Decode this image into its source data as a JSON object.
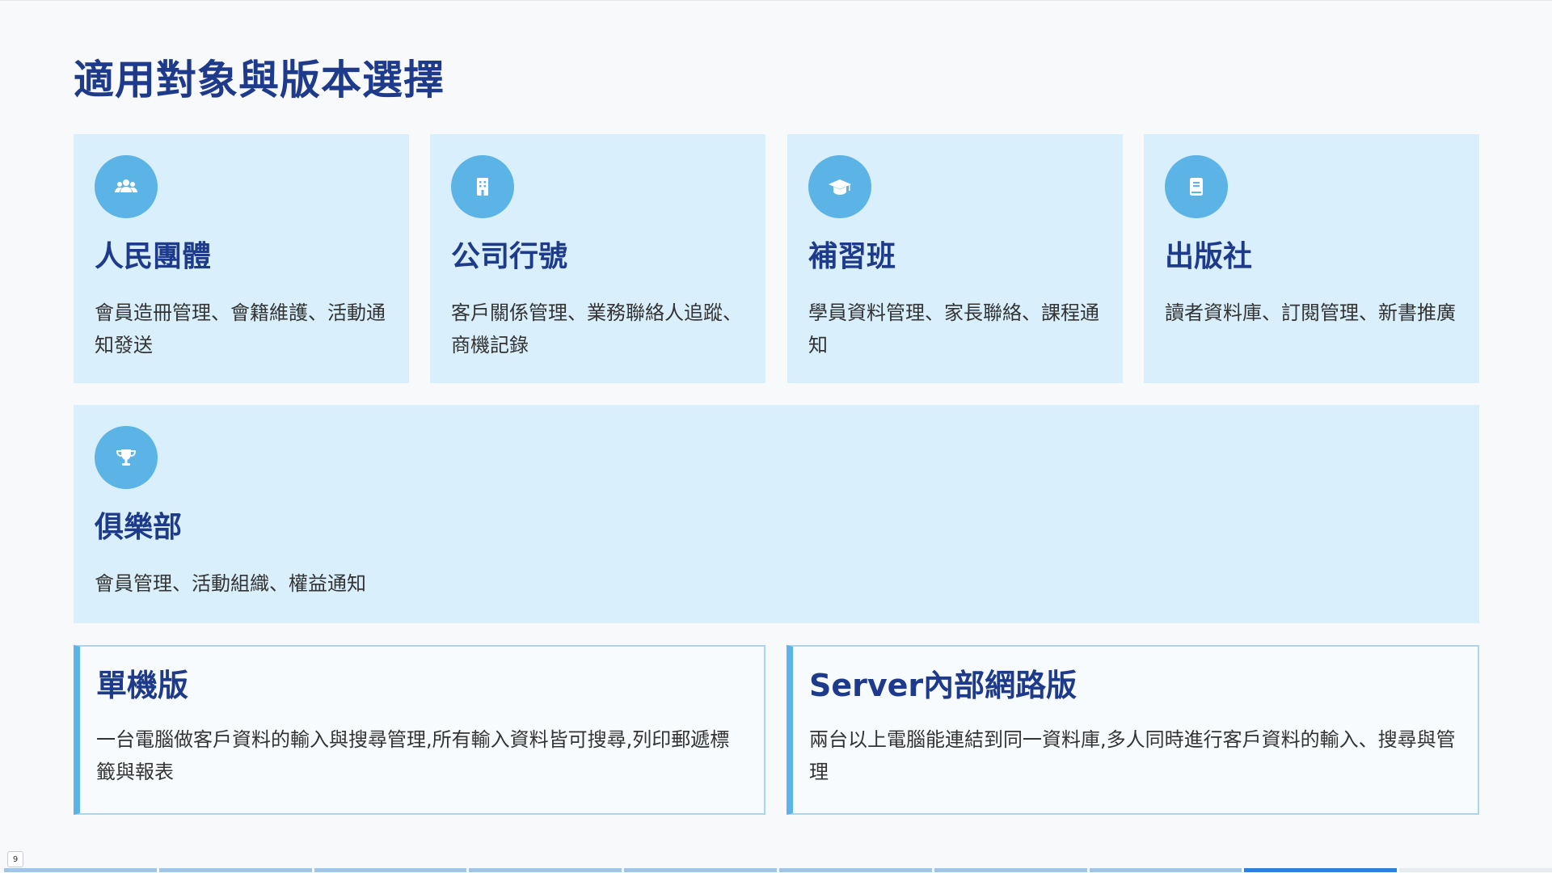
{
  "title": "適用對象與版本選擇",
  "audiences": [
    {
      "icon": "users-icon",
      "name": "人民團體",
      "desc": "會員造冊管理、會籍維護、活動通知發送"
    },
    {
      "icon": "building-icon",
      "name": "公司行號",
      "desc": "客戶關係管理、業務聯絡人追蹤、商機記錄"
    },
    {
      "icon": "graduation-cap-icon",
      "name": "補習班",
      "desc": "學員資料管理、家長聯絡、課程通知"
    },
    {
      "icon": "book-icon",
      "name": "出版社",
      "desc": "讀者資料庫、訂閱管理、新書推廣"
    },
    {
      "icon": "trophy-icon",
      "name": "俱樂部",
      "desc": "會員管理、活動組織、權益通知"
    }
  ],
  "versions": [
    {
      "name": "單機版",
      "desc": "一台電腦做客戶資料的輸入與搜尋管理,所有輸入資料皆可搜尋,列印郵遞標籤與報表"
    },
    {
      "name": "Server內部網路版",
      "desc": "兩台以上電腦能連結到同一資料庫,多人同時進行客戶資料的輸入、搜尋與管理"
    }
  ],
  "page_number": "9",
  "colors": {
    "accent": "#5cb3e6",
    "title": "#1e3a8a",
    "card_bg": "#d9effb",
    "progress_active": "#2f7fe0"
  }
}
